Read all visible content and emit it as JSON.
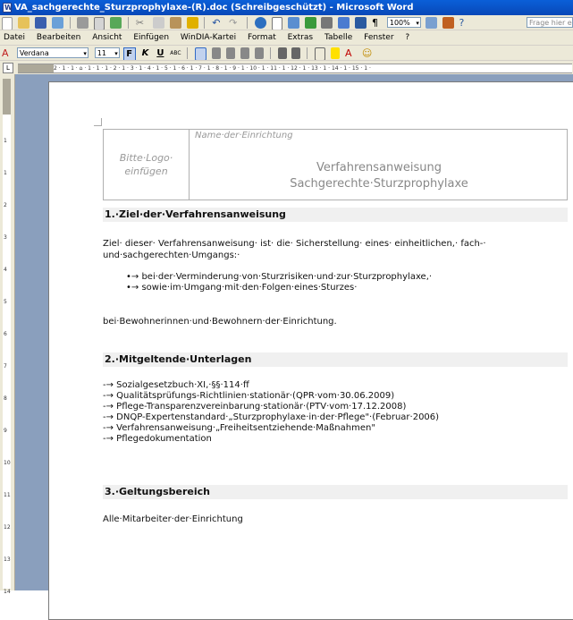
{
  "window": {
    "title": "VA_sachgerechte_Sturzprophylaxe-(R).doc (Schreibgeschützt) - Microsoft Word"
  },
  "menu": [
    "Datei",
    "Bearbeiten",
    "Ansicht",
    "Einfügen",
    "WinDIA-Kartei",
    "Format",
    "Extras",
    "Tabelle",
    "Fenster",
    "?"
  ],
  "help_placeholder": "Frage hier e",
  "toolbar": {
    "zoom": "100%",
    "style_icon": "style-pane-icon",
    "font": "Verdana",
    "font_size": "11",
    "bold": "F",
    "italic": "K",
    "underline": "U",
    "abc": "ABC",
    "smiley": "☺"
  },
  "ruler": {
    "h_scale": "2 · 1 · 1 · ⌂ · 1 · 1 · 1 · 2 · 1 · 3 · 1 · 4 · 1 · 5 · 1 · 6 · 1 · 7 · 1 · 8 · 1 · 9 · 1 · 10 · 1 · 11 · 1 · 12 · 1 · 13 · 1 · 14 · 1 · 15 · 1 ·",
    "v_numbers": [
      "2",
      "1",
      "1",
      "2",
      "3",
      "4",
      "5",
      "6",
      "7",
      "8",
      "9",
      "10",
      "11",
      "12",
      "13",
      "14"
    ]
  },
  "document": {
    "logo_placeholder": "Bitte·Logo·\neinfügen",
    "institution_placeholder": "Name·der·Einrichtung",
    "title_line1": "Verfahrensanweisung",
    "title_line2": "Sachgerechte·Sturzprophylaxe",
    "section1": {
      "heading": "1.·Ziel·der·Verfahrensanweisung",
      "para": "Ziel· dieser· Verfahrensanweisung· ist· die· Sicherstellung· eines· einheitlichen,· fach-· und·sachgerechten·Umgangs:·",
      "bullets": [
        "•→ bei·der·Verminderung·von·Sturzrisiken·und·zur·Sturzprophylaxe,·",
        "•→ sowie·im·Umgang·mit·den·Folgen·eines·Sturzes·"
      ],
      "closing": "bei·Bewohnerinnen·und·Bewohnern·der·Einrichtung."
    },
    "section2": {
      "heading": "2.·Mitgeltende·Unterlagen",
      "items": [
        "-→ Sozialgesetzbuch·XI,·§§·114·ff",
        "-→ Qualitätsprüfungs-Richtlinien·stationär·(QPR·vom·30.06.2009)",
        "-→ Pflege-Transparenzvereinbarung·stationär·(PTV·vom·17.12.2008)",
        "-→ DNQP-Expertenstandard·„Sturzprophylaxe·in·der·Pflege\"·(Februar·2006)",
        "-→ Verfahrensanweisung·„Freiheitsentziehende·Maßnahmen\"",
        "-→ Pflegedokumentation"
      ]
    },
    "section3": {
      "heading": "3.·Geltungsbereich",
      "para": "Alle·Mitarbeiter·der·Einrichtung"
    }
  },
  "colors": {
    "title_bar": "#0a5fd8",
    "toolbar_bg": "#ece9d8",
    "workspace": "#8a9fbd",
    "section_bg": "#f0f0f0"
  }
}
